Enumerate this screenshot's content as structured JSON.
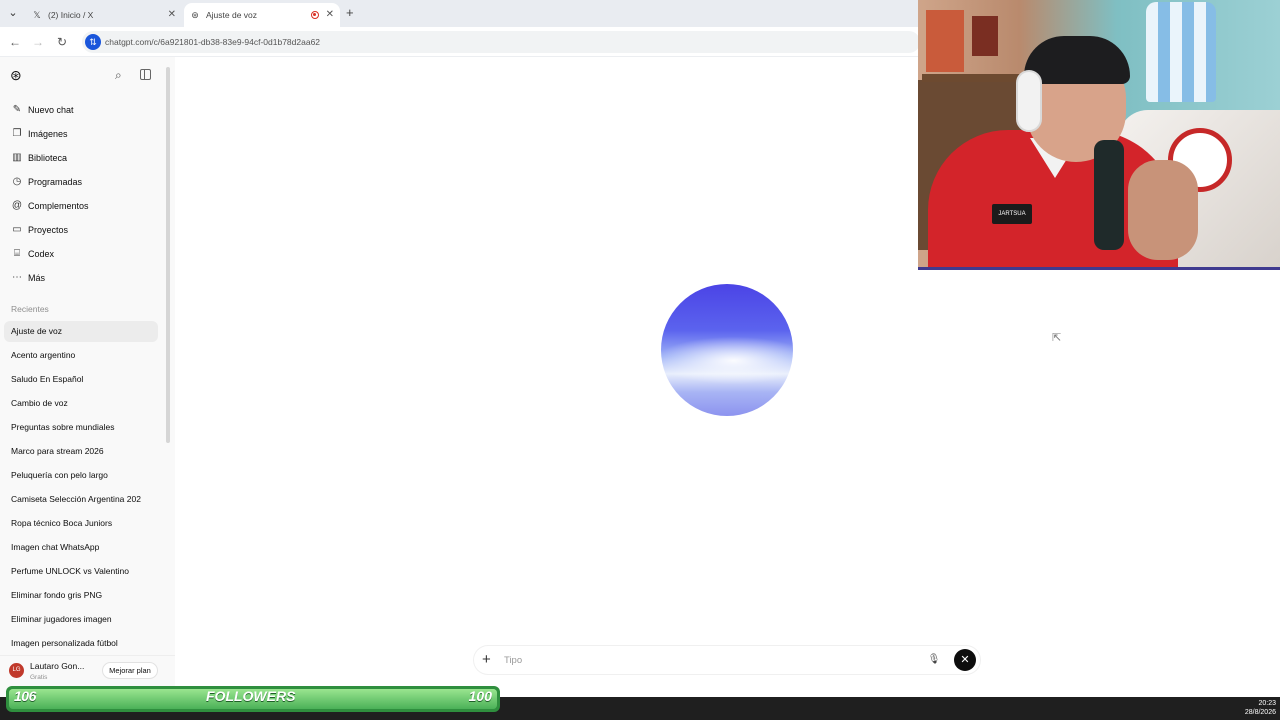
{
  "browser": {
    "tabs": [
      {
        "title": "(2) Inicio / X",
        "icon": "x-logo-icon"
      },
      {
        "title": "Ajuste de voz",
        "icon": "chatgpt-icon",
        "active": true
      }
    ],
    "url": "chatgpt.com/c/6a921801-db38-83e9-94cf-0d1b78d2aa62"
  },
  "sidebar": {
    "menu": [
      {
        "label": "Nuevo chat",
        "icon": "edit-icon"
      },
      {
        "label": "Imágenes",
        "icon": "images-icon"
      },
      {
        "label": "Biblioteca",
        "icon": "library-icon"
      },
      {
        "label": "Programadas",
        "icon": "clock-icon"
      },
      {
        "label": "Complementos",
        "icon": "at-icon"
      },
      {
        "label": "Proyectos",
        "icon": "folder-icon"
      },
      {
        "label": "Codex",
        "icon": "codex-icon"
      },
      {
        "label": "Más",
        "icon": "more-icon"
      }
    ],
    "recents_label": "Recientes",
    "recents": [
      "Ajuste de voz",
      "Acento argentino",
      "Saludo En Español",
      "Cambio de voz",
      "Preguntas sobre mundiales",
      "Marco para stream 2026",
      "Peluquería con pelo largo",
      "Camiseta Selección Argentina 202",
      "Ropa técnico Boca Juniors",
      "Imagen chat WhatsApp",
      "Perfume UNLOCK vs Valentino",
      "Eliminar fondo gris PNG",
      "Eliminar jugadores imagen",
      "Imagen personalizada fútbol"
    ],
    "user": {
      "initials": "LG",
      "name": "Lautaro Gon...",
      "plan": "Gratis",
      "upgrade_label": "Mejorar plan"
    }
  },
  "composer": {
    "placeholder": "Tipo"
  },
  "stream_overlay": {
    "followers_current": "106",
    "followers_label": "FOLLOWERS",
    "followers_goal": "100",
    "followers_progress": 1.0,
    "webcam_badge": "JARTSUA"
  },
  "taskbar": {
    "time": "20:23",
    "date": "28/8/2026"
  },
  "colors": {
    "accent": "#0d0d0d",
    "orb_top": "#4b44e6",
    "followers_green": "#3fa34d"
  }
}
